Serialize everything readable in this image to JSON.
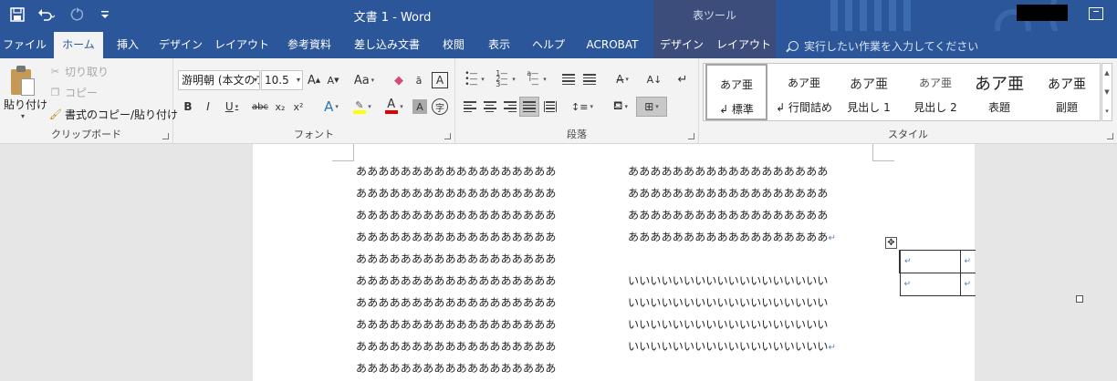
{
  "titlebar": {
    "title": "文書 1  -  Word",
    "context_group": "表ツール",
    "qat": [
      "save-icon",
      "undo-icon",
      "redo-icon",
      "customize-icon"
    ]
  },
  "tabs": {
    "items": [
      "ファイル",
      "ホーム",
      "挿入",
      "デザイン",
      "レイアウト",
      "参考資料",
      "差し込み文書",
      "校閲",
      "表示",
      "ヘルプ",
      "ACROBAT"
    ],
    "active": "ホーム",
    "context_tabs": [
      "デザイン",
      "レイアウト"
    ],
    "tellme": "実行したい作業を入力してください"
  },
  "clipboard": {
    "paste": "貼り付け",
    "cut": "切り取り",
    "copy": "コピー",
    "format_painter": "書式のコピー/貼り付け",
    "label": "クリップボード"
  },
  "font": {
    "name": "游明朝 (本文のフォント)",
    "size": "10.5",
    "label": "フォント",
    "grow": "A",
    "shrink": "A",
    "case": "Aa",
    "bold": "B",
    "italic": "I",
    "underline": "U",
    "strike": "abc",
    "subscript": "x₂",
    "superscript": "x²",
    "highlight_color": "#ffff00",
    "font_color": "#e00000"
  },
  "paragraph": {
    "label": "段落"
  },
  "styles": {
    "label": "スタイル",
    "sample": "あア亜",
    "items": [
      {
        "name": "↲ 標準"
      },
      {
        "name": "↲ 行間詰め"
      },
      {
        "name": "見出し 1"
      },
      {
        "name": "見出し 2"
      },
      {
        "name": "表題"
      },
      {
        "name": "副題"
      }
    ]
  },
  "document": {
    "left_column": [
      "ああああああああああああああああああ",
      "ああああああああああああああああああ",
      "ああああああああああああああああああ",
      "ああああああああああああああああああ",
      "ああああああああああああああああああ",
      "ああああああああああああああああああ",
      "ああああああああああああああああああ",
      "ああああああああああああああああああ",
      "ああああああああああああああああああ",
      "ああああああああああああああああああ"
    ],
    "right_column_a": [
      "ああああああああああああああああああ",
      "ああああああああああああああああああ",
      "ああああああああああああああああああ",
      "ああああああああああああああああああ"
    ],
    "right_column_b": [
      "いいいいいいいいいいいいいいいいいい",
      "いいいいいいいいいいいいいいいいいい",
      "いいいいいいいいいいいいいいいいいい",
      "いいいいいいいいいいいいいいいいいい"
    ],
    "paragraph_mark": "↵",
    "table_move_handle": "✥",
    "cell_mark": "↵"
  }
}
